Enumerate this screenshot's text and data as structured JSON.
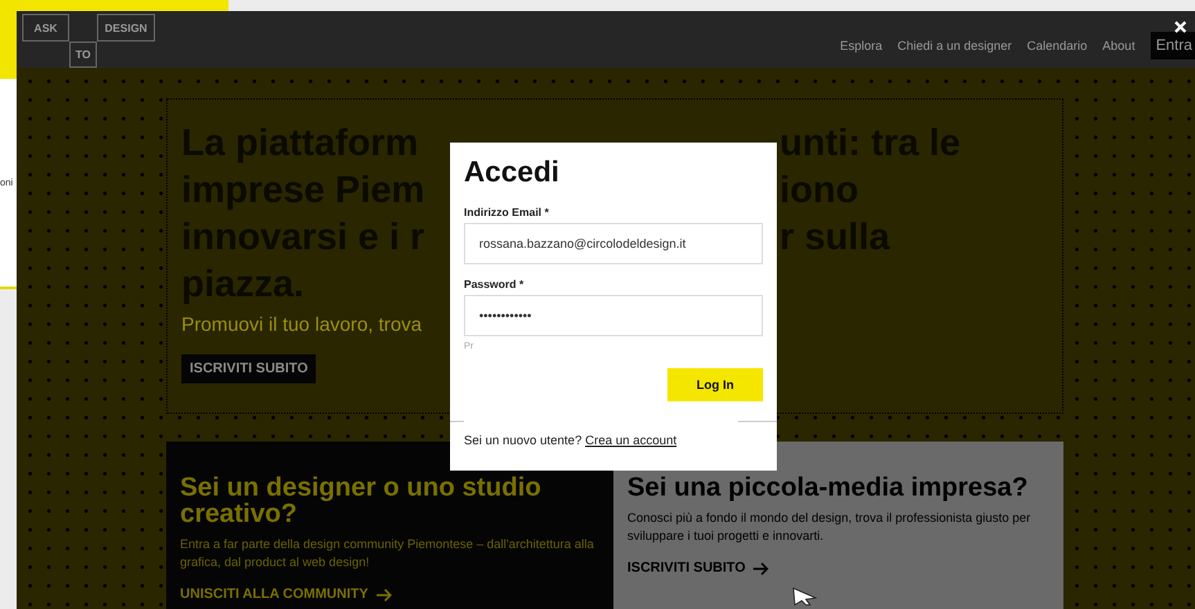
{
  "background_window": {
    "text": "oni"
  },
  "header": {
    "logo": [
      "ASK",
      "TO",
      "DESIGN"
    ],
    "nav": [
      "Esplora",
      "Chiedi a un designer",
      "Calendario",
      "About"
    ],
    "login_button": "Entra"
  },
  "hero": {
    "heading_lines": [
      {
        "left": "La piattaform",
        "right": "unti: tra le"
      },
      {
        "left": "imprese Piem",
        "right": "iono"
      },
      {
        "left": "innovarsi e i r",
        "right": "r sulla"
      },
      {
        "left": "piazza."
      }
    ],
    "subtitle": "Promuovi il tuo lavoro, trova",
    "button": "ISCRIVITI SUBITO"
  },
  "cards": [
    {
      "kind": "dark",
      "title": "Sei un designer o uno studio creativo?",
      "text": "Entra a far parte della design community Piemontese – dall'architettura alla grafica, dal product al web design!",
      "link": "UNISCITI ALLA COMMUNITY"
    },
    {
      "kind": "grey",
      "title": "Sei una piccola-media impresa?",
      "text": "Conosci più a fondo il mondo del design, trova il professionista giusto per sviluppare i tuoi progetti e innovarti.",
      "link": "ISCRIVITI SUBITO"
    }
  ],
  "modal": {
    "title": "Accedi",
    "fields": [
      {
        "label": "Indirizzo Email *",
        "value": "rossana.bazzano@circolodeldesign.it"
      },
      {
        "label": "Password *",
        "value": "••••••••••••"
      }
    ],
    "hint": "Pr",
    "submit": "Log In",
    "footer_text": "Sei un nuovo utente?",
    "footer_link": "Crea un account"
  }
}
